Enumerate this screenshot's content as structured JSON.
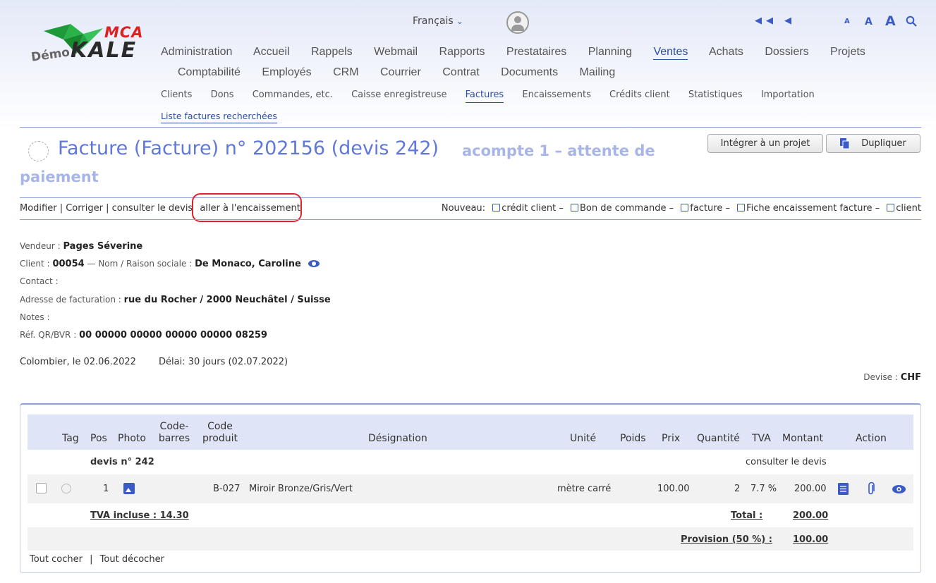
{
  "logo": {
    "brand": "MCA",
    "demo": "Démo",
    "product": "KALE"
  },
  "topbar": {
    "language": "Français"
  },
  "font_sizes": [
    "A",
    "A",
    "A"
  ],
  "main_nav": {
    "row1": [
      "Administration",
      "Accueil",
      "Rappels",
      "Webmail",
      "Rapports",
      "Prestataires",
      "Planning",
      "Ventes",
      "Achats",
      "Dossiers",
      "Projets"
    ],
    "row2": [
      "Comptabilité",
      "Employés",
      "CRM",
      "Courrier",
      "Contrat",
      "Documents",
      "Mailing"
    ],
    "active": "Ventes"
  },
  "sub_nav": {
    "items": [
      "Clients",
      "Dons",
      "Commandes, etc.",
      "Caisse enregistreuse",
      "Factures",
      "Encaissements",
      "Crédits client",
      "Statistiques",
      "Importation"
    ],
    "active": "Factures"
  },
  "subsub_nav": "Liste factures recherchées",
  "page": {
    "title": "Facture (Facture) n° 202156 (devis 242)",
    "status_line1": "acompte 1 – attente de",
    "status_line2": "paiement",
    "btn_project": "Intégrer à un projet",
    "btn_duplicate": "Dupliquer"
  },
  "actions": {
    "modify": "Modifier",
    "correct": "Corriger",
    "consult_quote": "consulter le devis",
    "go_payment": "aller à l'encaissement",
    "new_label": "Nouveau:",
    "new_items": [
      "crédit client",
      "Bon de commande",
      "facture",
      "Fiche encaissement facture",
      "client"
    ]
  },
  "info": {
    "seller_label": "Vendeur :",
    "seller": "Pages Séverine",
    "client_label": "Client :",
    "client_id": "00054",
    "name_label": "— Nom / Raison sociale :",
    "client_name": "De Monaco, Caroline",
    "contact_label": "Contact :",
    "billing_label": "Adresse de facturation :",
    "billing": "rue du Rocher / 2000 Neuchâtel / Suisse",
    "notes_label": "Notes :",
    "ref_label": "Réf. QR/BVR :",
    "ref": "00 00000 00000 00000 00000 08259",
    "place_date": "Colombier, le 02.06.2022",
    "delay": "Délai: 30 jours (02.07.2022)",
    "currency_label": "Devise :",
    "currency": "CHF"
  },
  "table": {
    "headers": {
      "tag": "Tag",
      "pos": "Pos",
      "photo": "Photo",
      "barcode_1": "Code-",
      "barcode_2": "barres",
      "product_1": "Code",
      "product_2": "produit",
      "designation": "Désignation",
      "unit": "Unité",
      "weight": "Poids",
      "price": "Prix",
      "quantity": "Quantité",
      "vat": "TVA",
      "amount": "Montant",
      "action": "Action"
    },
    "group_label": "devis n° 242",
    "group_link": "consulter le devis",
    "rows": [
      {
        "pos": "1",
        "product_code": "B-027",
        "designation": "Miroir Bronze/Gris/Vert",
        "unit": "mètre carré",
        "price": "100.00",
        "quantity": "2",
        "vat": "7.7 %",
        "amount": "200.00"
      }
    ],
    "vat_included": "TVA incluse : 14.30",
    "total_label": "Total :",
    "total": "200.00",
    "provision_label": "Provision (50 %) :",
    "provision": "100.00",
    "check_all": "Tout cocher",
    "uncheck_all": "Tout décocher"
  }
}
